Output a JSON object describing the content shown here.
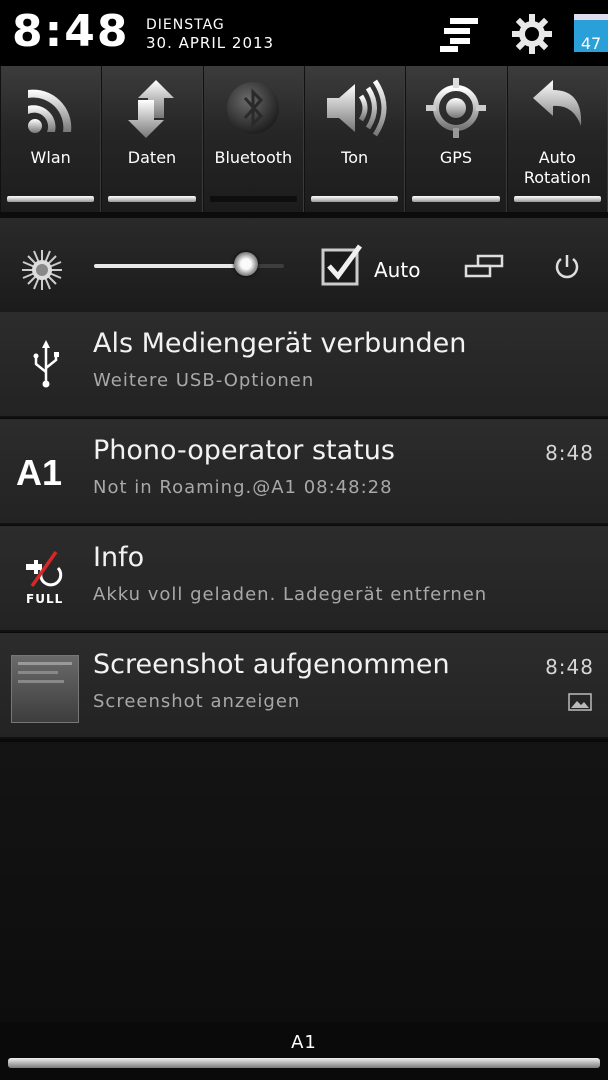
{
  "header": {
    "time": "8:48",
    "day": "DIENSTAG",
    "date": "30. APRIL 2013",
    "menu_icon": "menu-lines-icon",
    "settings_icon": "gear-icon",
    "battery_level": "47",
    "battery_color": "#2aa0d8"
  },
  "toggles": [
    {
      "label": "Wlan",
      "icon": "wifi-icon",
      "active": true
    },
    {
      "label": "Daten",
      "icon": "data-arrows-icon",
      "active": true
    },
    {
      "label": "Bluetooth",
      "icon": "bluetooth-icon",
      "active": false
    },
    {
      "label": "Ton",
      "icon": "speaker-icon",
      "active": true
    },
    {
      "label": "GPS",
      "icon": "gps-target-icon",
      "active": true
    },
    {
      "label": "Auto Rotation",
      "icon": "rotate-arrow-icon",
      "active": true
    }
  ],
  "brightness": {
    "level_percent": 80,
    "auto_label": "Auto",
    "auto_checked": true
  },
  "notifications": [
    {
      "title": "Als Mediengerät verbunden",
      "subtitle": "Weitere USB-Optionen",
      "time": "",
      "icon": "usb-icon"
    },
    {
      "title": "Phono-operator status",
      "subtitle": "Not in Roaming.@A1 08:48:28",
      "time": "8:48",
      "icon": "a1-logo-icon"
    },
    {
      "title": "Info",
      "subtitle": "Akku voll geladen. Ladegerät entfernen",
      "time": "",
      "icon": "battery-full-icon",
      "icon_text": "FULL"
    },
    {
      "title": "Screenshot aufgenommen",
      "subtitle": "Screenshot anzeigen",
      "time": "8:48",
      "icon": "screenshot-thumbnail-icon"
    }
  ],
  "carrier": "A1"
}
